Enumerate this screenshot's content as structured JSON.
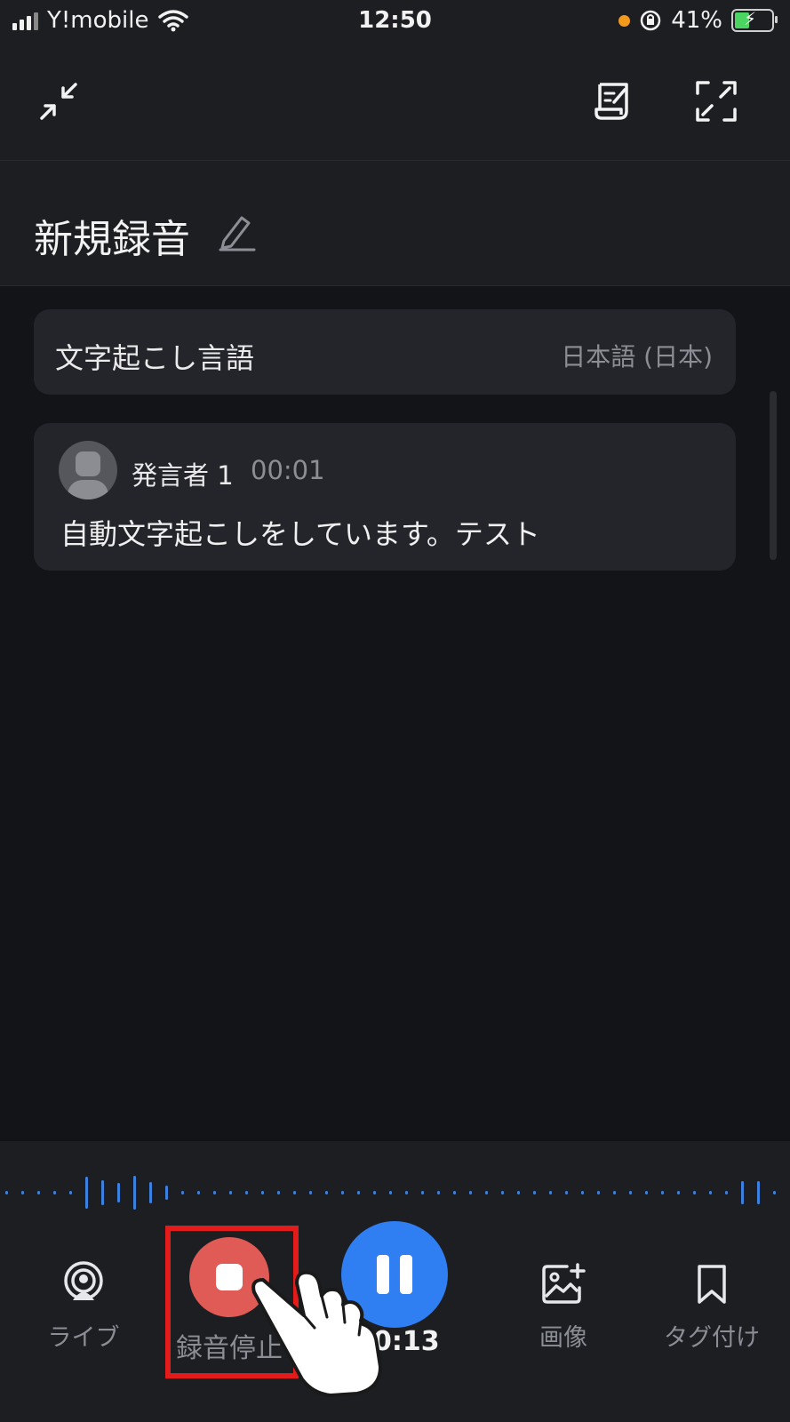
{
  "status_bar": {
    "carrier": "Y!mobile",
    "time": "12:50",
    "battery": "41%"
  },
  "title": {
    "text": "新規録音"
  },
  "language": {
    "label": "文字起こし言語",
    "value": "日本語 (日本)"
  },
  "transcript": {
    "speaker": "発言者 1",
    "timestamp": "00:01",
    "text": "自動文字起こしをしています。テスト"
  },
  "controls": {
    "live_label": "ライブ",
    "stop_label": "録音停止",
    "timer": "0:13",
    "image_label": "画像",
    "tag_label": "タグ付け"
  },
  "colors": {
    "accent_blue": "#2f7ef2",
    "stop_red": "#e05a56",
    "highlight_red": "#e31b1b"
  }
}
